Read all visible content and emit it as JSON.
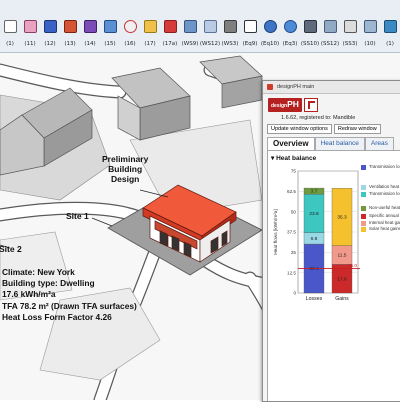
{
  "toolbar": {
    "buttons": [
      {
        "icon": "select-arrow-icon",
        "label": "(1)"
      },
      {
        "icon": "eraser-icon",
        "label": "(11)"
      },
      {
        "icon": "paint-bucket-icon",
        "label": "(12)"
      },
      {
        "icon": "box-icon",
        "label": "(13)"
      },
      {
        "icon": "components-icon",
        "label": "(14)"
      },
      {
        "icon": "walk-icon",
        "label": "(15)"
      },
      {
        "icon": "help-icon",
        "label": "(16)"
      },
      {
        "icon": "folder-icon",
        "label": "(17)"
      },
      {
        "icon": "push-pull-icon",
        "label": "(17a)"
      },
      {
        "icon": "section-plane-icon",
        "label": "(WS9)"
      },
      {
        "icon": "section-fill-icon",
        "label": "(WS12)"
      },
      {
        "icon": "section-display-icon",
        "label": "(WS3)"
      },
      {
        "icon": "move-arrow-icon",
        "label": "(Eq9)"
      },
      {
        "icon": "globe-icon",
        "label": "(Eq10)"
      },
      {
        "icon": "globe-add-icon",
        "label": "(Eq3)"
      },
      {
        "icon": "display-settings-icon",
        "label": "(SS10)"
      },
      {
        "icon": "scenes-icon",
        "label": "(SS12)"
      },
      {
        "icon": "print-icon",
        "label": "(SS3)"
      },
      {
        "icon": "home-icon",
        "label": "(10)"
      },
      {
        "icon": "view-icon",
        "label": "(1)"
      }
    ]
  },
  "scene": {
    "callout_preliminary": [
      "Preliminary",
      "Building",
      "Design"
    ],
    "site1": "Site 1",
    "site2": "Site 2",
    "info_lines": [
      "Climate: New York",
      "Building type: Dwelling",
      "17.6 kWh/m²a",
      "TFA  78.2 m² (Drawn TFA surfaces)",
      "Heat Loss Form Factor 4.26"
    ]
  },
  "plugin": {
    "title": "designPH main",
    "brand_small": "design",
    "brand_big": "PH",
    "version": "1.6.62, registered to: Mandible",
    "options_button": "Update window options",
    "redraw_button": "Redraw window",
    "tabs": [
      "Overview",
      "Heat balance",
      "Areas"
    ],
    "active_tab": "Overview",
    "section": "Heat balance"
  },
  "colors": {
    "transmission_opaque": "#4a57c9",
    "ventilation": "#9bd8e6",
    "transmission_windows": "#3ec6c0",
    "non_useful_heat": "#6f9b3c",
    "specific_annual": "#cc2a2a",
    "internal_heat_gains": "#f19a8c",
    "solar_heat_gains": "#f5c12e",
    "building_red": "#e8402a"
  },
  "chart_data": {
    "type": "bar",
    "stacked": true,
    "ylabel": "Heat flows [kWh/m²a]",
    "ylim": [
      0,
      75
    ],
    "yticks": [
      0,
      12.5,
      25,
      37.5,
      50,
      62.5,
      75
    ],
    "categories": [
      "Losses",
      "Gains"
    ],
    "series": [
      {
        "name": "Transmission losses (opaque surfaces incl. thermal bridges)",
        "values": [
          30.1,
          0
        ]
      },
      {
        "name": "Ventilation heat losses",
        "values": [
          6.9,
          0
        ]
      },
      {
        "name": "Transmission losses (windows)",
        "values": [
          23.8,
          0
        ]
      },
      {
        "name": "Non-useful heat",
        "values": [
          3.7,
          0
        ]
      },
      {
        "name": "Specific annual heat demand",
        "values": [
          0,
          17.6
        ]
      },
      {
        "name": "Internal heat gains",
        "values": [
          0,
          11.5
        ]
      },
      {
        "name": "Solar heat gains",
        "values": [
          0,
          35.3
        ]
      }
    ],
    "bar_labels": {
      "losses": [
        "30.1",
        "6.9",
        "23.8",
        "3.7"
      ],
      "gains": [
        "17.6",
        "11.5",
        "35.3"
      ]
    },
    "reference_line": {
      "value": 15.0,
      "label": "15.0"
    }
  }
}
